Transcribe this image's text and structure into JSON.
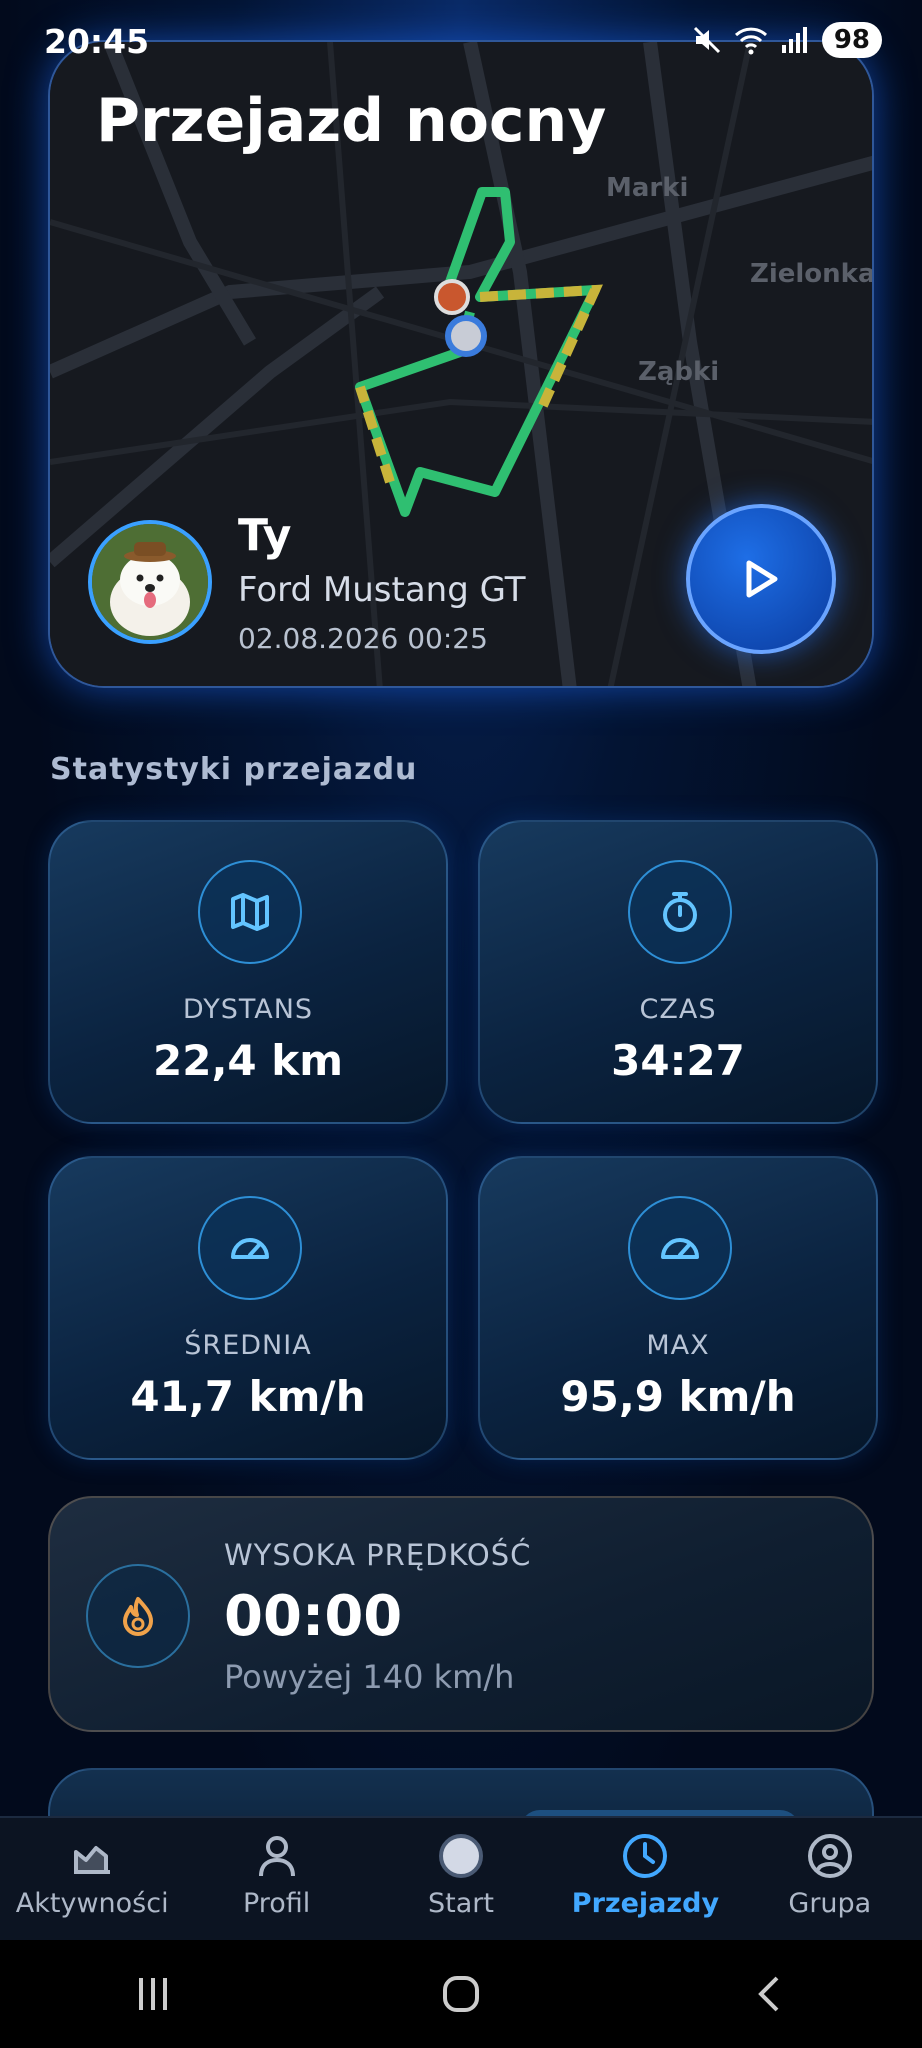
{
  "status_bar": {
    "time": "20:45",
    "battery": "98"
  },
  "ride": {
    "title": "Przejazd nocny",
    "map_labels": [
      "Marki",
      "Zielonka",
      "Ząbki"
    ],
    "user": "Ty",
    "car": "Ford Mustang GT",
    "date": "02.08.2026 00:25"
  },
  "stats": {
    "section_title": "Statystyki przejazdu",
    "items": [
      {
        "label": "DYSTANS",
        "value": "22,4 km",
        "icon": "map-icon"
      },
      {
        "label": "CZAS",
        "value": "34:27",
        "icon": "stopwatch-icon"
      },
      {
        "label": "ŚREDNIA",
        "value": "41,7 km/h",
        "icon": "speedometer-icon"
      },
      {
        "label": "MAX",
        "value": "95,9 km/h",
        "icon": "speedometer-icon"
      }
    ],
    "high_speed": {
      "label": "WYSOKA PRĘDKOŚĆ",
      "value": "00:00",
      "sub": "Powyżej 140 km/h",
      "icon": "flame-icon"
    }
  },
  "nav": {
    "items": [
      {
        "label": "Aktywności",
        "icon": "chart-icon"
      },
      {
        "label": "Profil",
        "icon": "person-icon"
      },
      {
        "label": "Start",
        "icon": "start-dot-icon"
      },
      {
        "label": "Przejazdy",
        "icon": "clock-icon",
        "active": true
      },
      {
        "label": "Grupa",
        "icon": "group-icon"
      }
    ]
  },
  "colors": {
    "accent": "#42a8ff",
    "route_green": "#2fbf71",
    "route_yellow": "#c8b43a"
  }
}
